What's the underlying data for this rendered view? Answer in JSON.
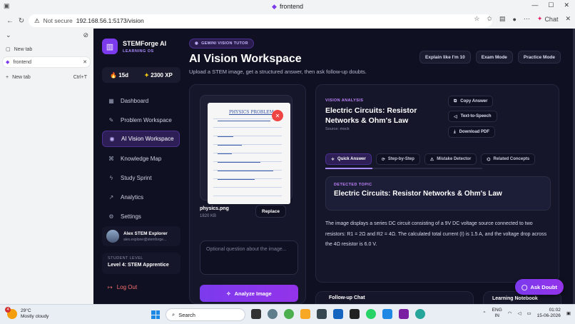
{
  "browser": {
    "window_title": "frontend",
    "url_security": "Not secure",
    "url": "192.168.56.1:5173/vision",
    "chat_label": "Chat"
  },
  "vertical_tabs": {
    "items": [
      {
        "label": "New tab",
        "shortcut": ""
      },
      {
        "label": "frontend",
        "shortcut": ""
      },
      {
        "label": "New tab",
        "shortcut": "Ctrl+T"
      }
    ]
  },
  "app": {
    "brand_name": "STEMForge AI",
    "brand_sub": "LEARNING OS",
    "streak": "15d",
    "xp": "2300 XP",
    "nav": [
      {
        "label": "Dashboard",
        "icon": "grid-icon"
      },
      {
        "label": "Problem Workspace",
        "icon": "edit-icon"
      },
      {
        "label": "AI Vision Workspace",
        "icon": "eye-icon"
      },
      {
        "label": "Knowledge Map",
        "icon": "map-icon"
      },
      {
        "label": "Study Sprint",
        "icon": "bolt-icon"
      },
      {
        "label": "Analytics",
        "icon": "chart-icon"
      },
      {
        "label": "Settings",
        "icon": "gear-icon"
      }
    ],
    "user_name": "Alex STEM Explorer",
    "user_email": "alex.explorer@stemforge...",
    "level_heading": "STUDENT LEVEL",
    "level_value": "Level 4: STEM Apprentice",
    "logout": "Log Out"
  },
  "main": {
    "badge": "GEMINI VISION TUTOR",
    "title": "AI Vision Workspace",
    "subtitle": "Upload a STEM image, get a structured answer, then ask follow-up doubts.",
    "top_buttons": [
      "Explain like I'm 10",
      "Exam Mode",
      "Practice Mode"
    ],
    "upload": {
      "paper_title": "PHYSICS PROBLEM",
      "file_name": "physics.png",
      "file_size": "1820 KB",
      "replace": "Replace",
      "question_placeholder": "Optional question about the image...",
      "analyze": "Analyze Image"
    },
    "result": {
      "label": "VISION ANALYSIS",
      "title": "Electric Circuits: Resistor Networks & Ohm's Law",
      "source": "Source: mock",
      "actions": [
        "Copy Answer",
        "Text-to-Speech",
        "Download PDF"
      ],
      "tabs": [
        "Quick Answer",
        "Step-by-Step",
        "Mistake Detector",
        "Related Concepts"
      ],
      "topic_label": "DETECTED TOPIC",
      "topic": "Electric Circuits: Resistor Networks & Ohm's Law",
      "answer": "The image displays a series DC circuit consisting of a 9V DC voltage source connected to two resistors: R1 = 2Ω and R2 = 4Ω. The calculated total current (I) is 1.5 A, and the voltage drop across the 4Ω resistor is 6.0 V."
    },
    "followup": "Follow-up Chat",
    "learning": "Learning Notebook",
    "ask_doubt": "Ask Doubt"
  },
  "taskbar": {
    "temp": "29°C",
    "weather": "Mostly cloudy",
    "weather_badge": "4",
    "search": "Search",
    "lang1": "ENG",
    "lang2": "IN",
    "time": "01:02",
    "date": "15-06-2026"
  },
  "colors": {
    "accent": "#7c3aed",
    "bg": "#0f1021",
    "panel": "#15162a"
  }
}
